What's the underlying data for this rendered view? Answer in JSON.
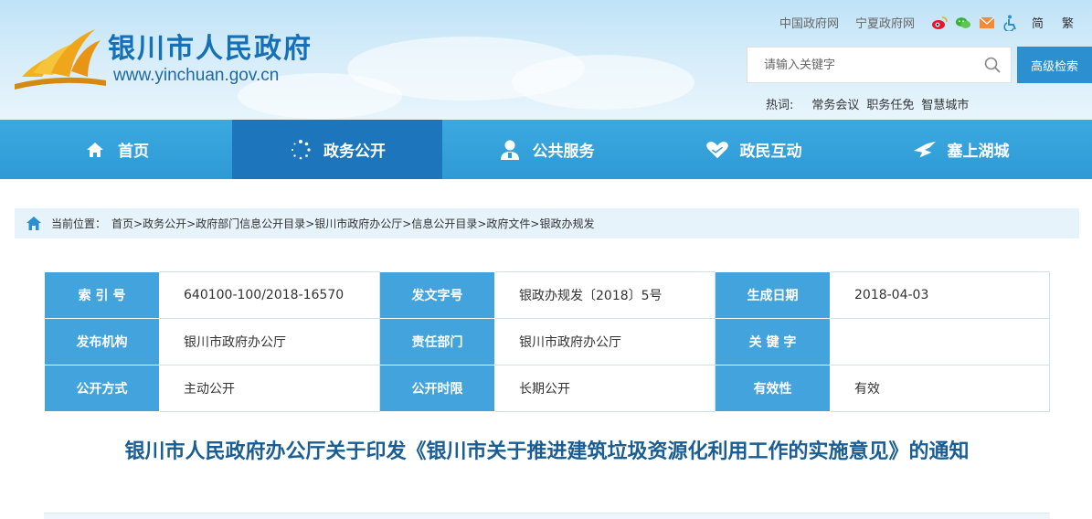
{
  "header": {
    "site_title": "银川市人民政府",
    "site_url": "www.yinchuan.gov.cn",
    "top_links": [
      "中国政府网",
      "宁夏政府网"
    ],
    "lang": [
      "简",
      "繁"
    ],
    "search": {
      "placeholder": "请输入关键字",
      "advanced_label": "高级检索"
    },
    "hot": {
      "label": "热词:",
      "items": [
        "常务会议",
        "职务任免",
        "智慧城市"
      ]
    }
  },
  "nav": {
    "items": [
      {
        "label": "首页",
        "icon": "home-icon"
      },
      {
        "label": "政务公开",
        "icon": "dots-circle-icon",
        "active": true
      },
      {
        "label": "公共服务",
        "icon": "person-icon"
      },
      {
        "label": "政民互动",
        "icon": "heart-hands-icon"
      },
      {
        "label": "塞上湖城",
        "icon": "crane-icon"
      }
    ]
  },
  "breadcrumb": {
    "label": "当前位置：",
    "items": [
      "首页",
      "政务公开",
      "政府部门信息公开目录",
      "银川市政府办公厅",
      "信息公开目录",
      "政府文件",
      "银政办规发"
    ]
  },
  "info": {
    "rows": [
      [
        {
          "k": "索 引 号",
          "v": "640100-100/2018-16570"
        },
        {
          "k": "发文字号",
          "v": "银政办规发〔2018〕5号"
        },
        {
          "k": "生成日期",
          "v": "2018-04-03"
        }
      ],
      [
        {
          "k": "发布机构",
          "v": "银川市政府办公厅"
        },
        {
          "k": "责任部门",
          "v": "银川市政府办公厅"
        },
        {
          "k": "关 键 字",
          "v": ""
        }
      ],
      [
        {
          "k": "公开方式",
          "v": "主动公开"
        },
        {
          "k": "公开时限",
          "v": "长期公开"
        },
        {
          "k": "有效性",
          "v": "有效"
        }
      ]
    ]
  },
  "doc_title": "银川市人民政府办公厅关于印发《银川市关于推进建筑垃圾资源化利用工作的实施意见》的通知",
  "colors": {
    "nav": "#2f9ad6",
    "nav_active": "#1d76bb",
    "label_cell": "#43a4dd",
    "title": "#1a5d93"
  }
}
